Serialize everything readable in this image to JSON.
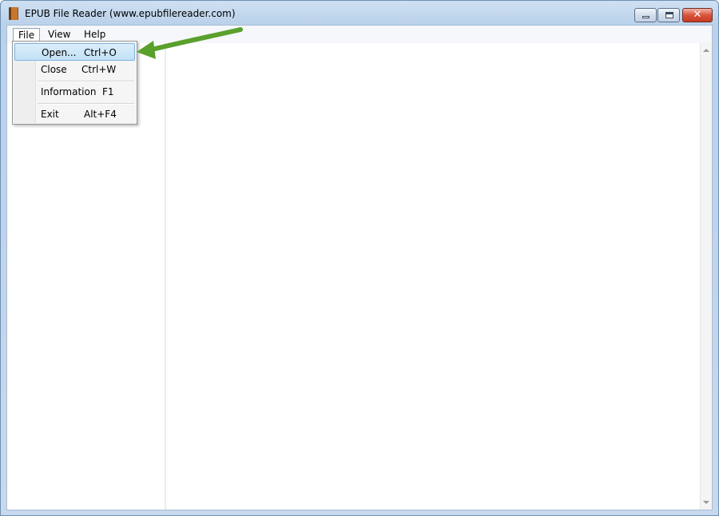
{
  "window": {
    "title": "EPUB File Reader (www.epubfilereader.com)",
    "icon": "book-icon",
    "close_glyph": "✕"
  },
  "menubar": {
    "items": [
      {
        "label": "File",
        "open": true
      },
      {
        "label": "View"
      },
      {
        "label": "Help"
      }
    ]
  },
  "file_menu": {
    "items": [
      {
        "label": "Open...",
        "shortcut": "Ctrl+O",
        "selected": true
      },
      {
        "label": "Close",
        "shortcut": "Ctrl+W"
      },
      {
        "label": "Information",
        "shortcut": "F1"
      },
      {
        "label": "Exit",
        "shortcut": "Alt+F4"
      }
    ]
  },
  "colors": {
    "annotation_arrow": "#5aa02c",
    "selected_item": "#c3e1f6"
  }
}
